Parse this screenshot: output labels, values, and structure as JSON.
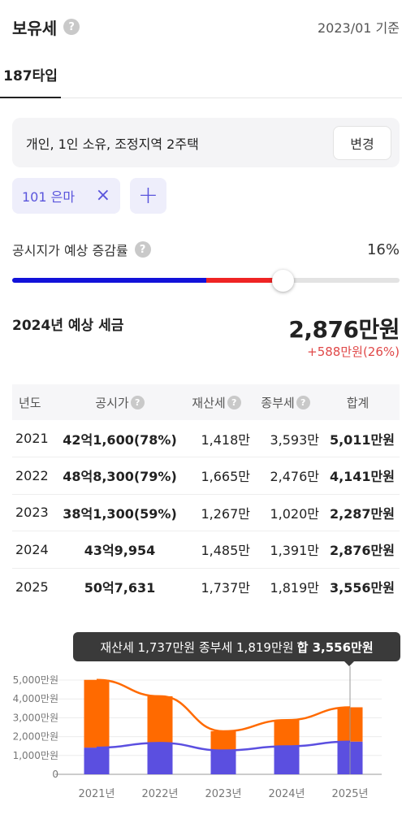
{
  "header": {
    "title": "보유세",
    "help_icon": "?",
    "basis": "2023/01 기준"
  },
  "tabs": [
    {
      "label": "187타입",
      "active": true
    }
  ],
  "condition": {
    "text": "개인, 1인 소유, 조정지역 2주택",
    "change_label": "변경"
  },
  "chips": [
    {
      "label": "101 은마",
      "remove_icon": "×"
    }
  ],
  "add_icon": "+",
  "rate": {
    "label": "공시지가 예상 증감률",
    "value": "16%",
    "slider_fraction": 0.7,
    "red_start_fraction": 0.5
  },
  "estimate": {
    "label": "2024년 예상 세금",
    "amount": "2,876만원",
    "diff": "+588만원(26%)"
  },
  "table": {
    "headers": {
      "year": "년도",
      "price": "공시가",
      "property": "재산세",
      "comprehensive": "종부세",
      "total": "합계"
    },
    "rows": [
      {
        "year": "2021",
        "price": "42억1,600(78%)",
        "property": "1,418만",
        "comprehensive": "3,593만",
        "total": "5,011만원"
      },
      {
        "year": "2022",
        "price": "48억8,300(79%)",
        "property": "1,665만",
        "comprehensive": "2,476만",
        "total": "4,141만원"
      },
      {
        "year": "2023",
        "price": "38억1,300(59%)",
        "property": "1,267만",
        "comprehensive": "1,020만",
        "total": "2,287만원"
      },
      {
        "year": "2024",
        "price": "43억9,954",
        "property": "1,485만",
        "comprehensive": "1,391만",
        "total": "2,876만원"
      },
      {
        "year": "2025",
        "price": "50억7,631",
        "property": "1,737만",
        "comprehensive": "1,819만",
        "total": "3,556만원"
      }
    ]
  },
  "tooltip": {
    "text": "재산세 1,737만원 종부세 1,819만원",
    "total_label": "합 3,556만원"
  },
  "colors": {
    "property": "#5b4fe0",
    "comprehensive": "#ff6a00",
    "slider_blue": "#1212d9",
    "slider_red": "#ef2424",
    "accent": "#5a55dc"
  },
  "chart_data": {
    "type": "bar",
    "categories": [
      "2021년",
      "2022년",
      "2023년",
      "2024년",
      "2025년"
    ],
    "series": [
      {
        "name": "재산세",
        "values": [
          1418,
          1665,
          1267,
          1485,
          1737
        ]
      },
      {
        "name": "종부세",
        "values": [
          3593,
          2476,
          1020,
          1391,
          1819
        ]
      }
    ],
    "stacked": true,
    "overlay_lines": true,
    "y_ticks": [
      "0",
      "1,000만원",
      "2,000만원",
      "3,000만원",
      "4,000만원",
      "5,000만원"
    ],
    "ylim": [
      0,
      5000
    ],
    "grid": true,
    "selected_category": "2025년"
  }
}
